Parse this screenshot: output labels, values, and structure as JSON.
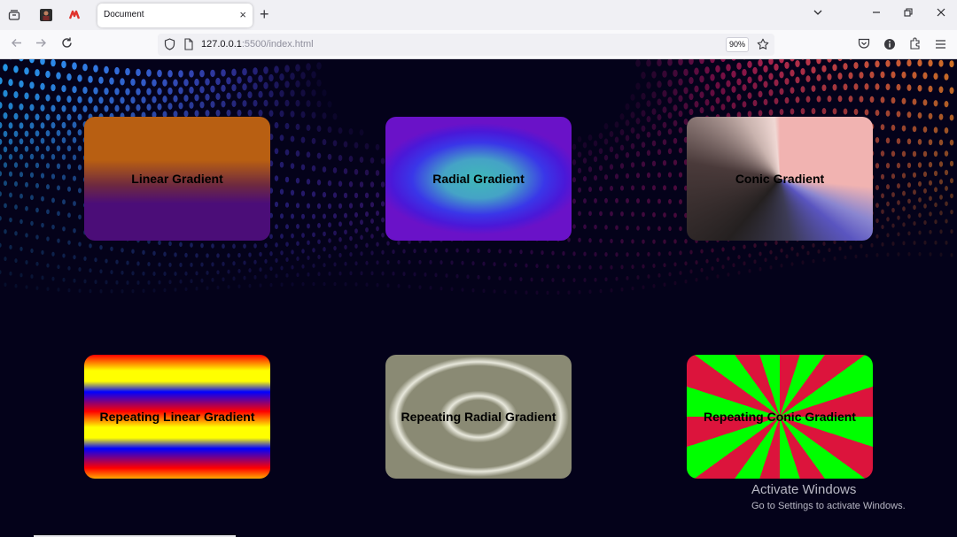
{
  "browser": {
    "tab": {
      "title": "Document",
      "close_glyph": "×"
    },
    "new_tab_glyph": "+",
    "url": {
      "host": "127.0.0.1",
      "rest": ":5500/index.html"
    },
    "zoom": "90%",
    "icons": {
      "tab_overview": "tab-overview-icon",
      "pinned_1": "pinned-site-icon",
      "pinned_2": "pinned-site-s-icon",
      "list_all_tabs": "chevron-down-icon",
      "minimize": "minimize-icon",
      "restore": "restore-icon",
      "close": "close-icon",
      "back": "back-arrow-icon",
      "forward": "forward-arrow-icon",
      "reload": "reload-icon",
      "shield": "shield-icon",
      "page": "page-icon",
      "bookmark": "star-icon",
      "pocket": "pocket-icon",
      "info": "info-icon",
      "extensions": "puzzle-icon",
      "menu": "hamburger-menu-icon"
    }
  },
  "cards": [
    {
      "label": "Linear Gradient",
      "style": "linear",
      "colors": [
        "#b85f12",
        "#4b0d78"
      ]
    },
    {
      "label": "Radial Gradient",
      "style": "radial",
      "colors": [
        "#3fb8b8",
        "#3a36e8",
        "#6a12c8"
      ]
    },
    {
      "label": "Conic Gradient",
      "style": "conic",
      "colors": [
        "#f1b3b1",
        "#5a55c0",
        "#242020"
      ]
    },
    {
      "label": "Repeating Linear Gradient",
      "style": "repeating-linear",
      "colors": [
        "#ff0000",
        "#ffff00",
        "#0000ff"
      ]
    },
    {
      "label": "Repeating Radial Gradient",
      "style": "repeating-radial",
      "colors": [
        "#8a8a74",
        "#e8e8dc"
      ]
    },
    {
      "label": "Repeating Conic Gradient",
      "style": "repeating-conic",
      "colors": [
        "#dc143c",
        "#00ff00"
      ]
    }
  ],
  "watermark": {
    "title": "Activate Windows",
    "subtitle": "Go to Settings to activate Windows."
  },
  "page_background": "#04021a"
}
